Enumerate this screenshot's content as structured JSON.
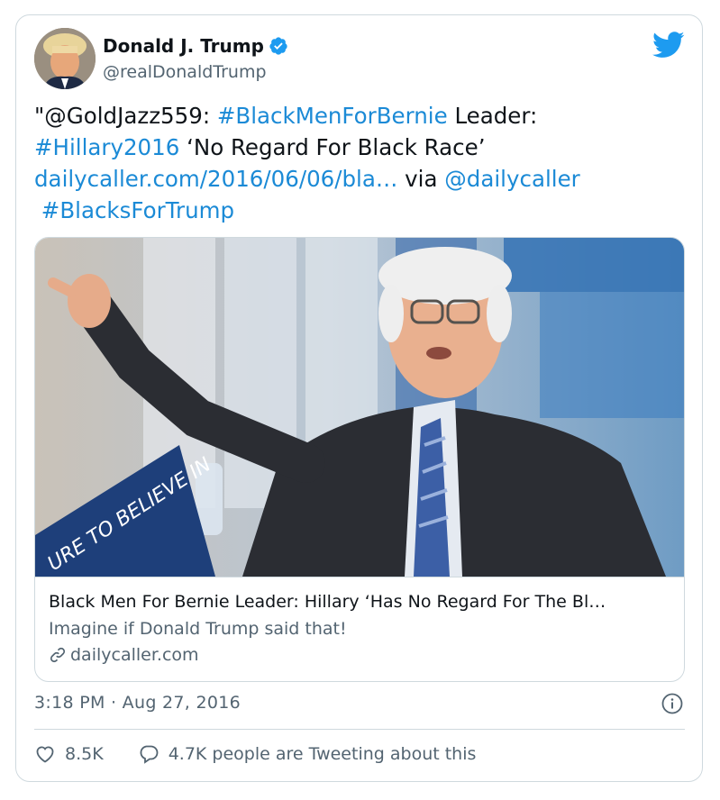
{
  "tweet": {
    "author_name": "Donald J. Trump",
    "author_handle": "@realDonaldTrump",
    "text_parts": {
      "mention_1": "\"@GoldJazz559: ",
      "hashtag_1": "#BlackMenForBernie",
      "text_1": " Leader:\n",
      "hashtag_2": "#Hillary2016",
      "text_2": " ‘No Regard For Black Race’\n",
      "url": "dailycaller.com/2016/06/06/bla…",
      "text_3": " via ",
      "mention_2": "@dailycaller",
      "text_4": "\n ",
      "hashtag_3": "#BlacksForTrump"
    },
    "link_card": {
      "photo_text": "URE TO BELIEVE IN",
      "title": "Black Men For Bernie Leader: Hillary ‘Has No Regard For The Bl…",
      "description": "Imagine if Donald Trump said that!",
      "domain": "dailycaller.com"
    },
    "timestamp": "3:18 PM · Aug 27, 2016",
    "likes": "8.5K",
    "tweeting_about": "4.7K people are Tweeting about this"
  },
  "colors": {
    "link": "#1b8ad6",
    "twitter_blue": "#1d9bf0",
    "secondary_text": "#536471",
    "border": "#cfd9de"
  },
  "icons": [
    "verified-badge-icon",
    "twitter-bird-icon",
    "link-icon",
    "info-icon",
    "heart-icon",
    "reply-bubble-icon"
  ]
}
